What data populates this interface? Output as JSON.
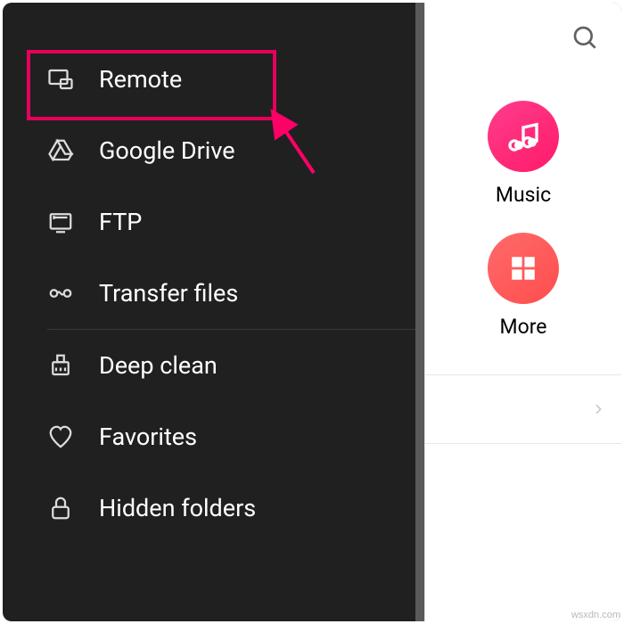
{
  "sidebar": {
    "items": [
      {
        "label": "Remote",
        "icon": "remote-icon"
      },
      {
        "label": "Google Drive",
        "icon": "gdrive-icon"
      },
      {
        "label": "FTP",
        "icon": "ftp-icon"
      },
      {
        "label": "Transfer files",
        "icon": "transfer-icon"
      },
      {
        "label": "Deep clean",
        "icon": "clean-icon"
      },
      {
        "label": "Favorites",
        "icon": "heart-icon"
      },
      {
        "label": "Hidden folders",
        "icon": "lock-icon"
      }
    ],
    "highlighted_index": 0
  },
  "right": {
    "tiles": {
      "music": {
        "label": "Music",
        "color": "#ff1a6b"
      },
      "more": {
        "label": "More",
        "color": "#ff4d4d"
      }
    }
  },
  "annotation": {
    "highlight_color": "#e6005c",
    "arrow_color": "#ff0066"
  },
  "watermark": "wsxdn.com"
}
